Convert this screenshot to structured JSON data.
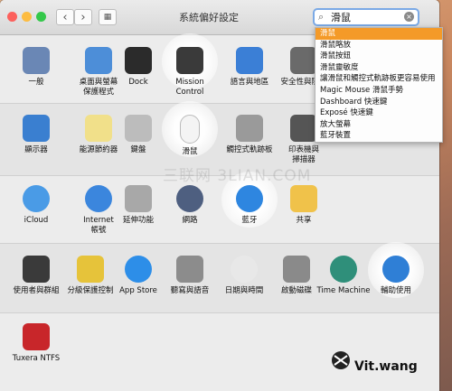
{
  "window": {
    "title": "系統偏好設定",
    "back": "‹",
    "forward": "›"
  },
  "search": {
    "value": "滑鼠",
    "suggestions": [
      "滑鼠",
      "滑鼠略放",
      "滑鼠按鈕",
      "滑鼠靈敏度",
      "讓滑鼠和觸控式軌跡板更容易使用",
      "Magic Mouse 滑鼠手勢",
      "Dashboard 快速鍵",
      "Exposé 快速鍵",
      "放大螢幕",
      "藍牙裝置"
    ]
  },
  "rows": [
    [
      {
        "label": "一般",
        "icon": "general-icon",
        "color": "#6a87b5"
      },
      {
        "label": "桌面與螢幕\n保護程式",
        "icon": "desktop-screensaver-icon",
        "color": "#4d8ed8"
      },
      {
        "label": "Dock",
        "icon": "dock-icon",
        "color": "#2b2b2b"
      },
      {
        "label": "Mission\nControl",
        "icon": "mission-control-icon",
        "color": "#3a3a3a"
      },
      {
        "label": "語言與地區",
        "icon": "language-region-icon",
        "color": "#3b7fd6"
      },
      {
        "label": "安全性與隱私",
        "icon": "security-icon",
        "color": "#6a6a6a"
      }
    ],
    [
      {
        "label": "顯示器",
        "icon": "displays-icon",
        "color": "#3a7fd0"
      },
      {
        "label": "能源節約器",
        "icon": "energy-saver-icon",
        "color": "#f1e08a"
      },
      {
        "label": "鍵盤",
        "icon": "keyboard-icon",
        "color": "#bcbcbc"
      },
      {
        "label": "滑鼠",
        "icon": "mouse-icon",
        "color": "#f4f4f4"
      },
      {
        "label": "觸控式軌跡板",
        "icon": "trackpad-icon",
        "color": "#9a9a9a"
      },
      {
        "label": "印表機與\n掃描器",
        "icon": "printer-icon",
        "color": "#555555"
      }
    ],
    [
      {
        "label": "iCloud",
        "icon": "icloud-icon",
        "color": "#4a9be6"
      },
      {
        "label": "Internet\n帳號",
        "icon": "internet-accounts-icon",
        "color": "#3b86dd"
      },
      {
        "label": "延伸功能",
        "icon": "extensions-icon",
        "color": "#a8a8a8"
      },
      {
        "label": "網路",
        "icon": "network-icon",
        "color": "#4e5f80"
      },
      {
        "label": "藍牙",
        "icon": "bluetooth-icon",
        "color": "#2e86e0"
      },
      {
        "label": "共享",
        "icon": "sharing-icon",
        "color": "#f0c24a"
      }
    ],
    [
      {
        "label": "使用者與群組",
        "icon": "users-groups-icon",
        "color": "#3a3a3a"
      },
      {
        "label": "分級保護控制",
        "icon": "parental-controls-icon",
        "color": "#e6c33a"
      },
      {
        "label": "App Store",
        "icon": "app-store-icon",
        "color": "#2d8ee8"
      },
      {
        "label": "聽寫與語音",
        "icon": "dictation-speech-icon",
        "color": "#8c8c8c"
      },
      {
        "label": "日期與時間",
        "icon": "date-time-icon",
        "color": "#e8e8e8"
      },
      {
        "label": "啟動磁碟",
        "icon": "startup-disk-icon",
        "color": "#8a8a8a"
      },
      {
        "label": "Time Machine",
        "icon": "time-machine-icon",
        "color": "#2f8f7a"
      },
      {
        "label": "輔助使用",
        "icon": "accessibility-icon",
        "color": "#2f7fd6"
      }
    ],
    [
      {
        "label": "Tuxera NTFS",
        "icon": "tuxera-ntfs-icon",
        "color": "#c8262a"
      }
    ]
  ],
  "highlights": [
    "mouse-icon",
    "mission-control-icon",
    "bluetooth-icon",
    "accessibility-icon"
  ],
  "watermark": "三联网 3LIAN.COM",
  "signature": "Vit.wang"
}
